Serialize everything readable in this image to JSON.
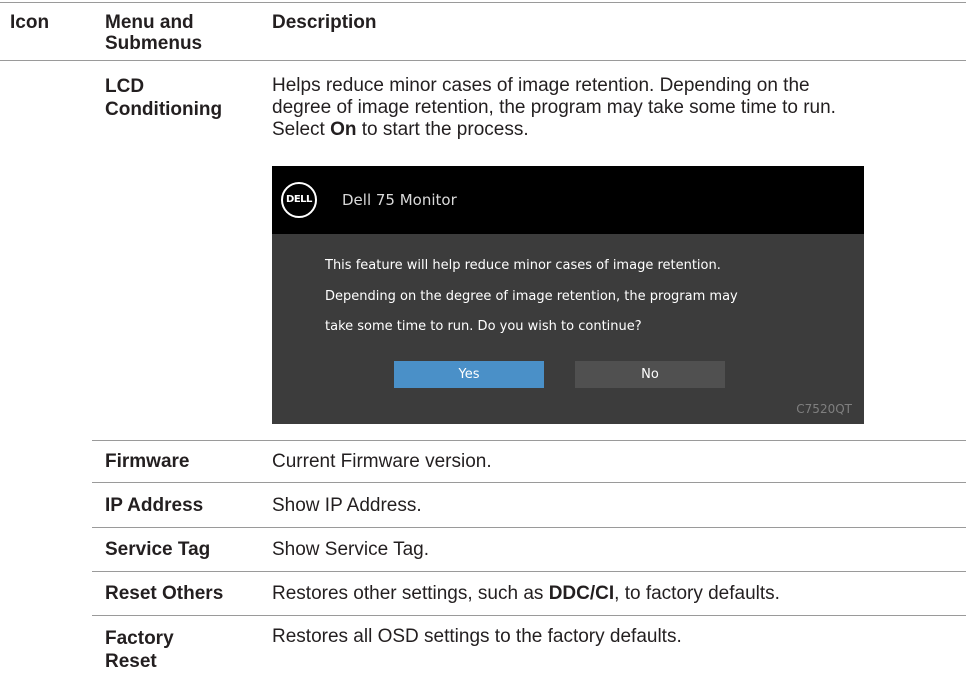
{
  "header": {
    "col_icon": "Icon",
    "col_menu_line1": "Menu and",
    "col_menu_line2": "Submenus",
    "col_desc": "Description"
  },
  "rows": {
    "lcd": {
      "label_line1": "LCD",
      "label_line2": "Conditioning",
      "desc_line1": "Helps reduce minor cases of image retention. Depending on the",
      "desc_line2": "degree of image retention, the program may take some time to run.",
      "desc_line3_pre": "Select ",
      "desc_line3_bold": "On",
      "desc_line3_post": " to start the process."
    },
    "firmware": {
      "label": "Firmware",
      "desc": "Current Firmware version."
    },
    "ip": {
      "label": "IP Address",
      "desc": "Show IP Address."
    },
    "service": {
      "label": "Service Tag",
      "desc": "Show Service Tag."
    },
    "reset_others": {
      "label": "Reset Others",
      "desc_pre": "Restores other settings, such as ",
      "desc_bold": "DDC/CI",
      "desc_post": ", to factory defaults."
    },
    "factory": {
      "label_line1": "Factory",
      "label_line2": "Reset",
      "desc": "Restores all OSD settings to the factory defaults."
    }
  },
  "osd": {
    "logo_text": "DELL",
    "title": "Dell 75 Monitor",
    "message_line1": "This feature will help reduce minor cases of image retention.",
    "message_line2": "Depending on the degree of image retention, the program may",
    "message_line3": "take some time to run. Do you wish to continue?",
    "yes_label": "Yes",
    "no_label": "No",
    "model": "C7520QT",
    "colors": {
      "header_bg": "#000000",
      "body_bg": "#3c3c3c",
      "yes_bg": "#4a90c8",
      "no_bg": "#505050"
    }
  }
}
